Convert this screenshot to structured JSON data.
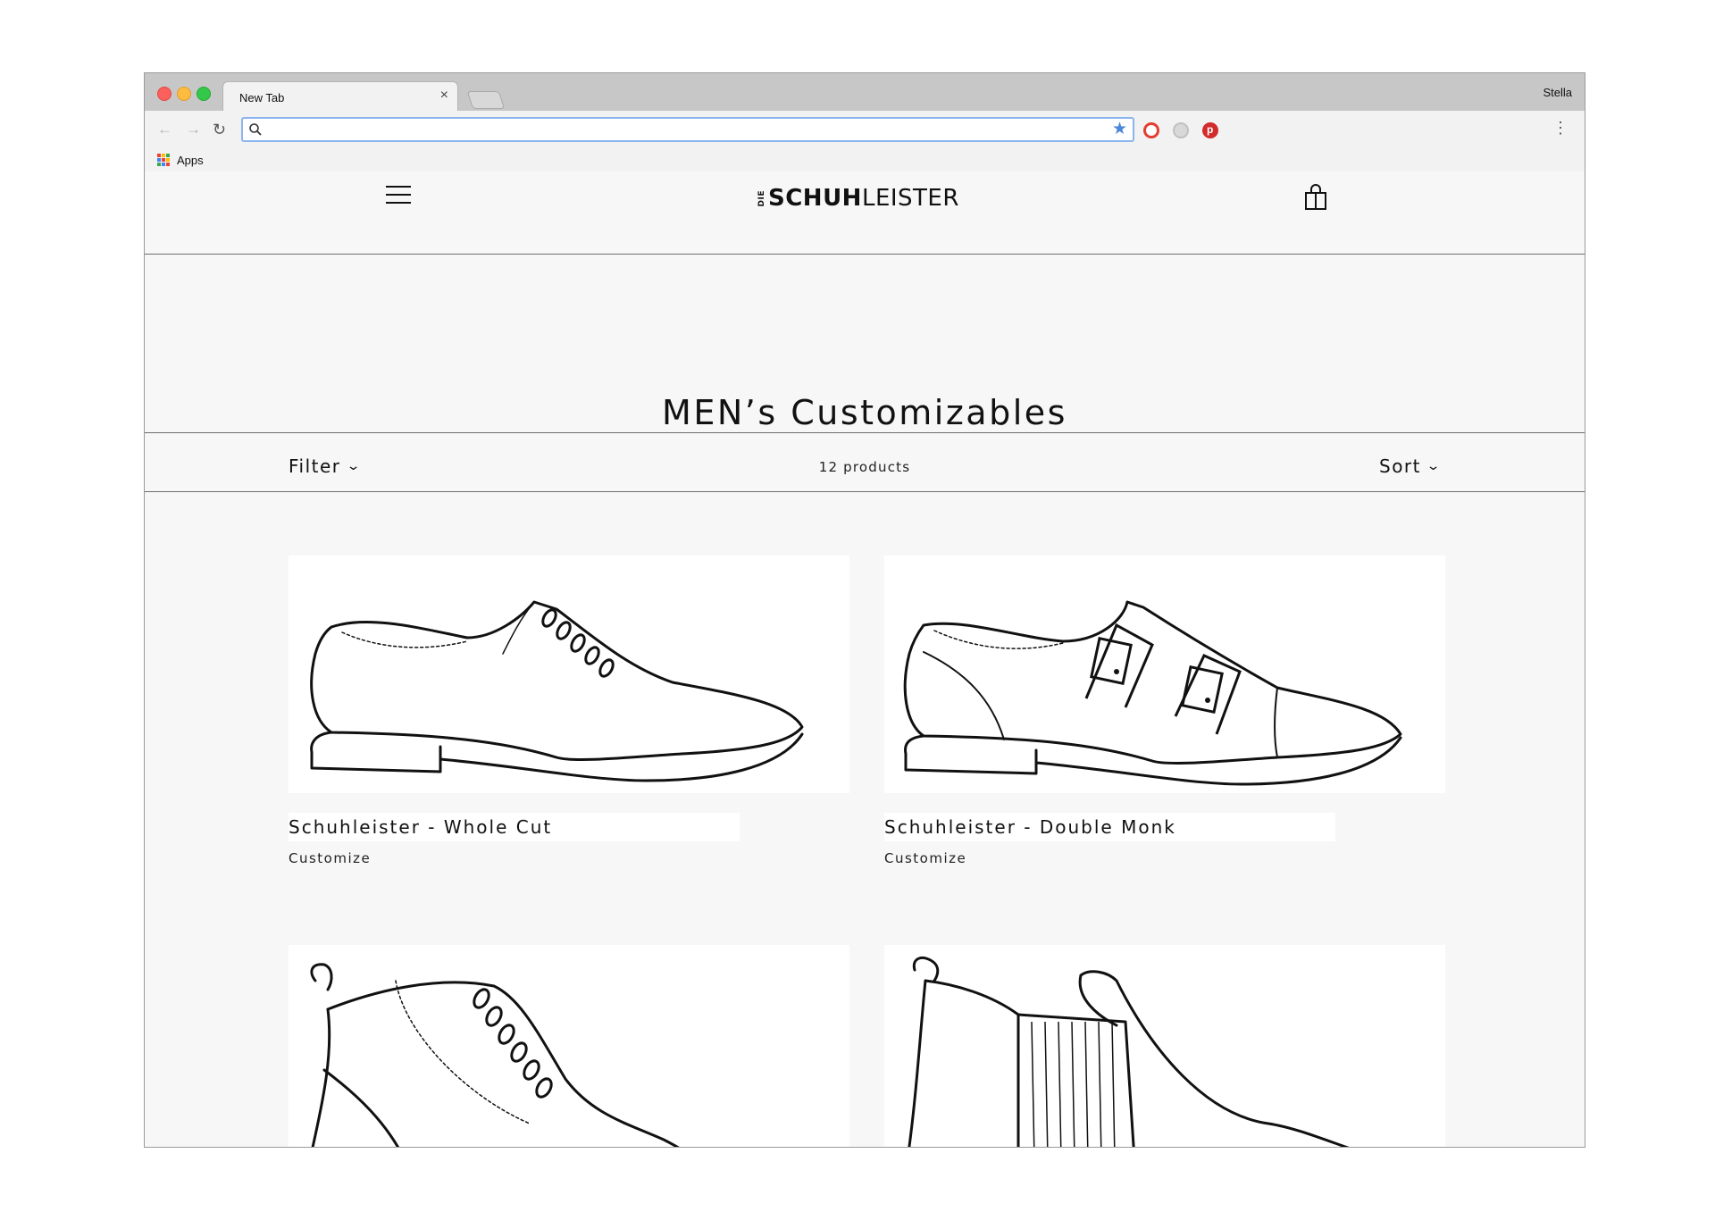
{
  "browser": {
    "tab_title": "New Tab",
    "tab_close": "×",
    "profile_name": "Stella",
    "omnibox_value": "",
    "bookmarks": {
      "apps_label": "Apps"
    }
  },
  "header": {
    "logo": {
      "prefix": "DIE",
      "bold": "SCHUH",
      "light": "LEISTER"
    }
  },
  "collection": {
    "title": "MEN’s Customizables",
    "filter_label": "Filter",
    "sort_label": "Sort",
    "product_count": "12 products"
  },
  "products": [
    {
      "name": "Schuhleister - Whole Cut",
      "action": "Customize",
      "icon": "oxford-shoe-sketch"
    },
    {
      "name": "Schuhleister - Double Monk",
      "action": "Customize",
      "icon": "monk-strap-shoe-sketch"
    },
    {
      "name": "",
      "action": "",
      "icon": "lace-up-boot-sketch"
    },
    {
      "name": "",
      "action": "",
      "icon": "chelsea-boot-sketch"
    }
  ],
  "colors": {
    "page_bg": "#f6f7f6",
    "text": "#111111",
    "chrome_bar": "#c8c7c8",
    "omnibox_focus": "#8bb5f0"
  }
}
